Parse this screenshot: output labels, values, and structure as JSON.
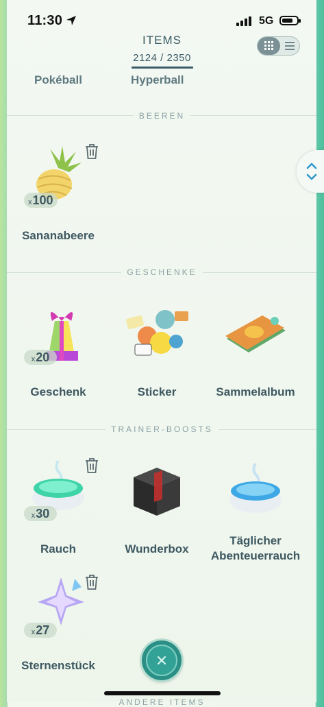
{
  "status_bar": {
    "time": "11:30",
    "network": "5G"
  },
  "header": {
    "title": "ITEMS",
    "count": "2124 / 2350"
  },
  "cut_off_labels": [
    "Pokéball",
    "Hyperball"
  ],
  "sections": {
    "beeren": {
      "title": "BEEREN",
      "items": [
        {
          "name": "Sananabeere",
          "quantity_prefix": "x",
          "quantity": "100"
        }
      ]
    },
    "geschenke": {
      "title": "GESCHENKE",
      "items": [
        {
          "name": "Geschenk",
          "quantity_prefix": "x",
          "quantity": "20"
        },
        {
          "name": "Sticker"
        },
        {
          "name": "Sammelalbum"
        }
      ]
    },
    "trainer_boosts": {
      "title": "TRAINER-BOOSTS",
      "items": [
        {
          "name": "Rauch",
          "quantity_prefix": "x",
          "quantity": "30"
        },
        {
          "name": "Wunderbox"
        },
        {
          "name_line1": "Täglicher",
          "name_line2": "Abenteuerrauch"
        },
        {
          "name": "Sternenstück",
          "quantity_prefix": "x",
          "quantity": "27"
        }
      ]
    },
    "andere_items": {
      "title": "ANDERE ITEMS"
    }
  },
  "icons": {
    "trash": "trash-icon",
    "location": "location-arrow-icon",
    "grid_view": "grid-view-icon",
    "list_view": "list-view-icon",
    "scroll_toggle": "chevron-up-down-icon",
    "close": "close-icon"
  },
  "colors": {
    "accent": "#2b8f86",
    "text": "#3e5861",
    "section": "#8ca1a5"
  }
}
